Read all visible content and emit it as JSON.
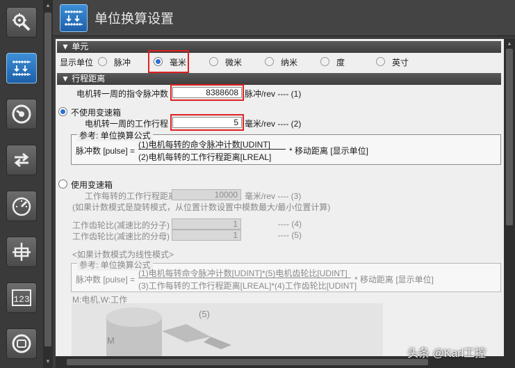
{
  "header": {
    "title": "单位换算设置"
  },
  "toolbar": {
    "icons": [
      "gear-search-icon",
      "unit-conversion-icon",
      "gauge-circle-icon",
      "arrows-swap-icon",
      "speedometer-icon",
      "cross-axis-icon",
      "digits-123-icon",
      "circle-stop-icon"
    ]
  },
  "unit_section": {
    "header": "▼ 单元",
    "label": "显示单位",
    "options": [
      "脉冲",
      "毫米",
      "微米",
      "纳米",
      "度",
      "英寸"
    ],
    "selected": "毫米"
  },
  "travel_section": {
    "header": "▼ 行程距离",
    "pulses_label": "电机转一周的指令脉冲数",
    "pulses_value": "8388608",
    "pulses_unit": "脉冲/rev ---- (1)"
  },
  "no_gear": {
    "label": "不使用变速箱",
    "travel_label": "电机转一周的工作行程",
    "travel_value": "5",
    "travel_unit": "毫米/rev ---- (2)",
    "ref_title": "参考: 单位换算公式",
    "formula_lhs": "脉冲数 [pulse] =",
    "numerator": "(1)电机每转的命令脉冲计数[UDINT]",
    "denominator": "(2)电机每转的工作行程距离[LREAL]",
    "formula_rhs": "* 移动距离 [显示单位]"
  },
  "with_gear": {
    "label": "使用变速箱",
    "travel_label": "工作每转的工作行程距离",
    "travel_value": "10000",
    "travel_unit": "毫米/rev ---- (3)",
    "note": "(如果计数模式是旋转模式，从位置计数设置中模数最大/最小位置计算)",
    "num_label": "工作齿轮比(减速比的分子)",
    "num_value": "1",
    "num_suffix": "---- (4)",
    "den_label": "工作齿轮比(减速比的分母)",
    "den_value": "1",
    "den_suffix": "---- (5)",
    "linear_note": "<如果计数模式为线性模式>",
    "ref_title": "参考: 单位换算公式",
    "formula_lhs": "脉冲数 [pulse] =",
    "numerator": "(1)电机每转命令脉冲计数[UDINT]*(5)电机齿轮比[UDINT]",
    "denominator": "(3)工作每转的工作行程距离[LREAL]*(4)工作齿轮比[UDINT]",
    "formula_rhs": "* 移动距离 [显示单位]",
    "diagram_caption": "M:电机,W:工作",
    "diagram_motor": "M",
    "diagram_gear": "(5)"
  },
  "watermark": "头条 @Karl工控"
}
